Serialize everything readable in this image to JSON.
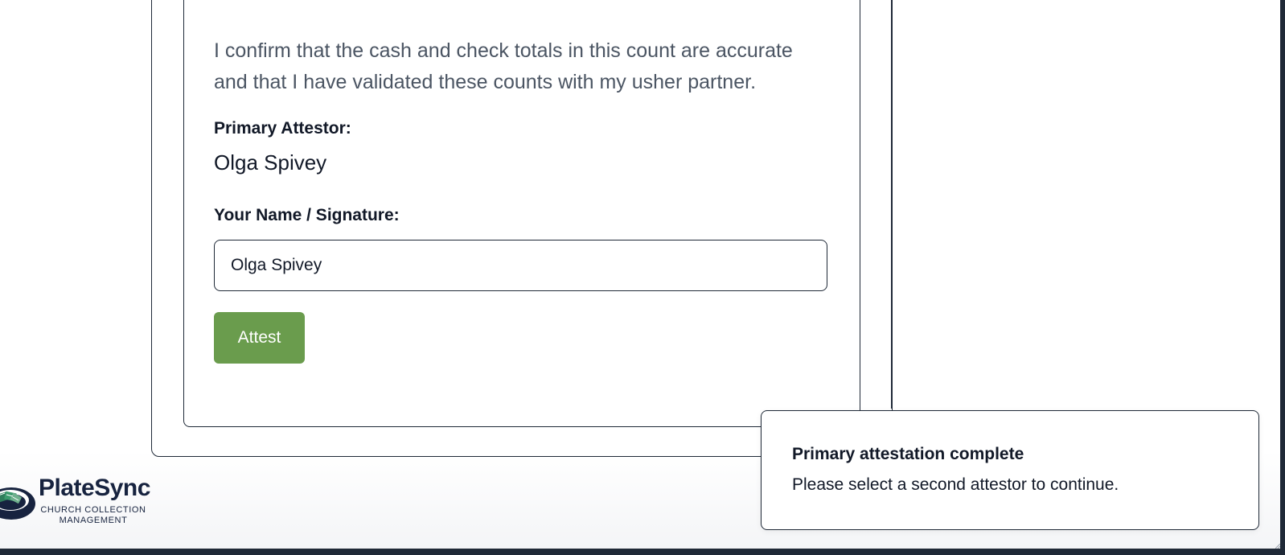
{
  "attestation": {
    "confirmation_text": "I confirm that the cash and check totals in this count are accurate and that I have validated these counts with my usher partner.",
    "primary_attestor_label": "Primary Attestor:",
    "primary_attestor_name": "Olga Spivey",
    "signature_label": "Your Name / Signature:",
    "signature_value": "Olga Spivey",
    "attest_button_label": "Attest"
  },
  "branding": {
    "name": "PlateSync",
    "tagline": "CHURCH COLLECTION MANAGEMENT",
    "colors": {
      "brand_navy": "#17233f",
      "brand_green": "#2f7d5b",
      "attest_green": "#6a9c4d"
    },
    "icon": "money-plate-icon"
  },
  "toast": {
    "title": "Primary attestation complete",
    "message": "Please select a second attestor to continue."
  }
}
